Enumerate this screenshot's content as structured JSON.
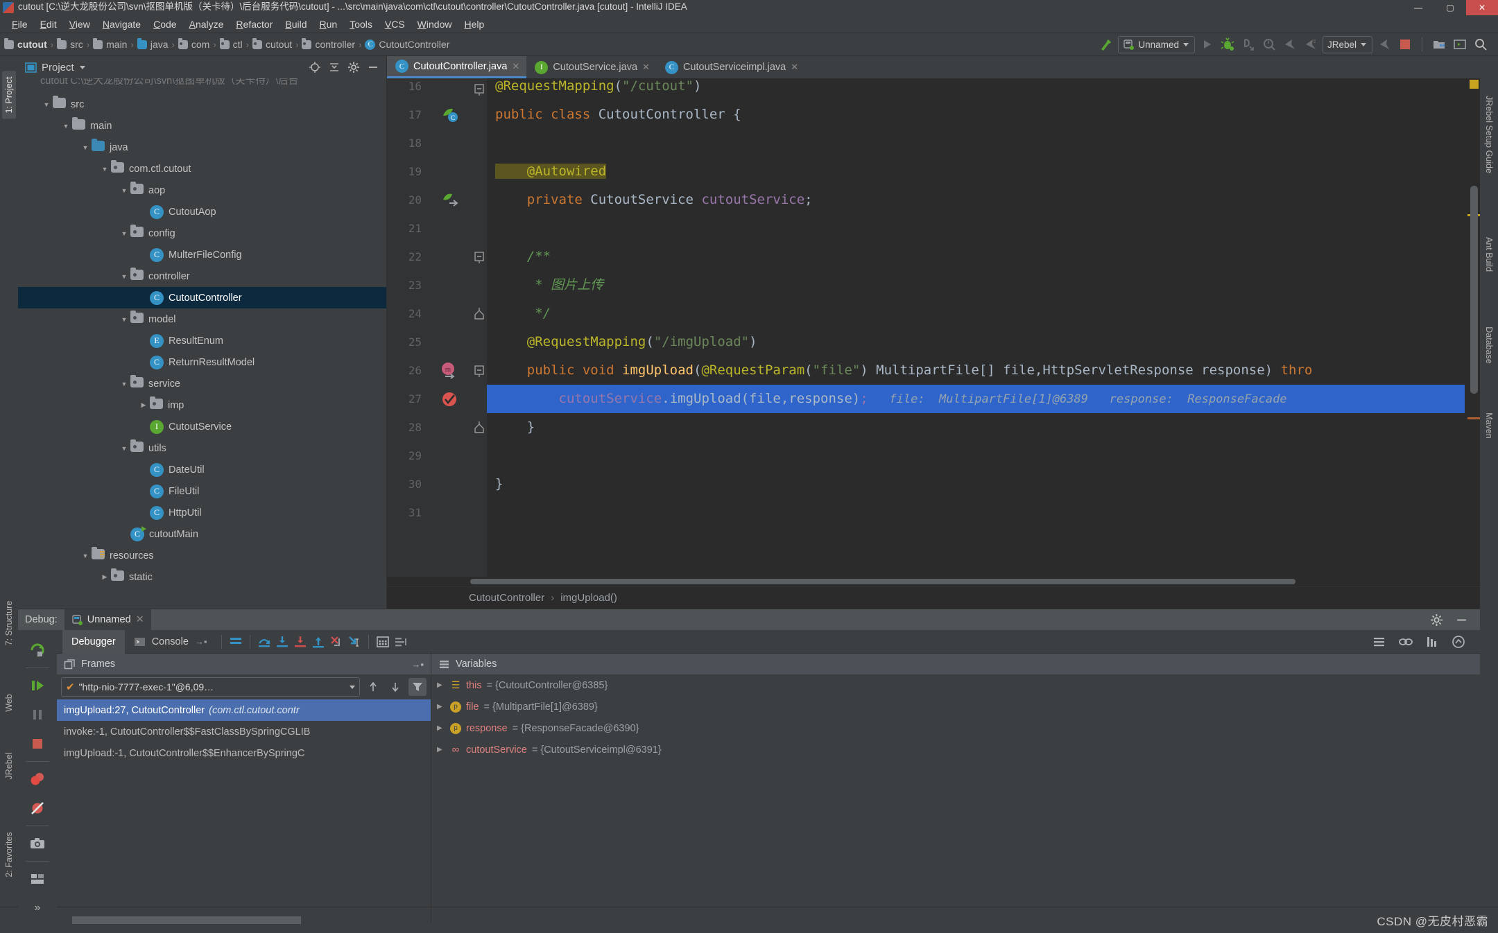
{
  "window": {
    "title": "cutout [C:\\逆大龙股份公司\\svn\\抠图单机版（关卡待）\\后台服务代码\\cutout] - ...\\src\\main\\java\\com\\ctl\\cutout\\controller\\CutoutController.java [cutout] - IntelliJ IDEA",
    "minimize": "—",
    "maximize": "▢",
    "close": "✕"
  },
  "menu": [
    "File",
    "Edit",
    "View",
    "Navigate",
    "Code",
    "Analyze",
    "Refactor",
    "Build",
    "Run",
    "Tools",
    "VCS",
    "Window",
    "Help"
  ],
  "breadcrumb": [
    {
      "label": "cutout",
      "icon": "module-icon",
      "bold": true
    },
    {
      "label": "src",
      "icon": "folder-icon"
    },
    {
      "label": "main",
      "icon": "folder-icon"
    },
    {
      "label": "java",
      "icon": "source-folder-icon"
    },
    {
      "label": "com",
      "icon": "package-icon"
    },
    {
      "label": "ctl",
      "icon": "package-icon"
    },
    {
      "label": "cutout",
      "icon": "package-icon"
    },
    {
      "label": "controller",
      "icon": "package-icon"
    },
    {
      "label": "CutoutController",
      "icon": "class-icon"
    }
  ],
  "toolbar": {
    "run_config": "Unnamed",
    "jrebel": "JRebel",
    "buttons": [
      "build-icon",
      "run-icon",
      "debug-icon",
      "run-with-coverage-icon",
      "profile-icon",
      "jrebel-run-icon",
      "jrebel-debug-icon",
      "jrebel-stop-icon",
      "stop-icon",
      "project-structure-icon",
      "terminal-icon",
      "search-icon"
    ]
  },
  "left_tool_window_bar": [
    {
      "label": "1: Project",
      "selected": true
    },
    {
      "label": "7: Structure",
      "selected": false
    },
    {
      "label": "Web",
      "selected": false
    },
    {
      "label": "JRebel",
      "selected": false
    },
    {
      "label": "2: Favorites",
      "selected": false
    }
  ],
  "right_tool_window_bar": [
    {
      "label": "JRebel Setup Guide"
    },
    {
      "label": "Ant Build"
    },
    {
      "label": "Database"
    },
    {
      "label": "Maven"
    }
  ],
  "project_panel": {
    "title": "Project",
    "header_icons": [
      "locate-icon",
      "collapse-all-icon",
      "settings-icon",
      "hide-icon"
    ],
    "root_clipped": "cutout C:\\逆大龙股份公司\\svn\\抠图单机版（关卡待）\\后台",
    "tree": [
      {
        "label": "src",
        "depth": 1,
        "type": "folder",
        "state": "open"
      },
      {
        "label": "main",
        "depth": 2,
        "type": "folder",
        "state": "open"
      },
      {
        "label": "java",
        "depth": 3,
        "type": "source-folder",
        "state": "open"
      },
      {
        "label": "com.ctl.cutout",
        "depth": 4,
        "type": "package",
        "state": "open"
      },
      {
        "label": "aop",
        "depth": 5,
        "type": "package",
        "state": "open"
      },
      {
        "label": "CutoutAop",
        "depth": 6,
        "type": "class",
        "state": "leaf"
      },
      {
        "label": "config",
        "depth": 5,
        "type": "package",
        "state": "open"
      },
      {
        "label": "MulterFileConfig",
        "depth": 6,
        "type": "class",
        "state": "leaf"
      },
      {
        "label": "controller",
        "depth": 5,
        "type": "package",
        "state": "open"
      },
      {
        "label": "CutoutController",
        "depth": 6,
        "type": "class",
        "state": "leaf",
        "selected": true
      },
      {
        "label": "model",
        "depth": 5,
        "type": "package",
        "state": "open"
      },
      {
        "label": "ResultEnum",
        "depth": 6,
        "type": "enum",
        "state": "leaf"
      },
      {
        "label": "ReturnResultModel",
        "depth": 6,
        "type": "class",
        "state": "leaf"
      },
      {
        "label": "service",
        "depth": 5,
        "type": "package",
        "state": "open"
      },
      {
        "label": "imp",
        "depth": 6,
        "type": "package",
        "state": "closed"
      },
      {
        "label": "CutoutService",
        "depth": 6,
        "type": "interface",
        "state": "leaf"
      },
      {
        "label": "utils",
        "depth": 5,
        "type": "package",
        "state": "open"
      },
      {
        "label": "DateUtil",
        "depth": 6,
        "type": "class",
        "state": "leaf"
      },
      {
        "label": "FileUtil",
        "depth": 6,
        "type": "class",
        "state": "leaf"
      },
      {
        "label": "HttpUtil",
        "depth": 6,
        "type": "class",
        "state": "leaf"
      },
      {
        "label": "cutoutMain",
        "depth": 5,
        "type": "runnable-class",
        "state": "leaf"
      },
      {
        "label": "resources",
        "depth": 3,
        "type": "resource-folder",
        "state": "open"
      },
      {
        "label": "static",
        "depth": 4,
        "type": "package",
        "state": "closed"
      }
    ]
  },
  "editor": {
    "tabs": [
      {
        "label": "CutoutController.java",
        "icon": "class-icon",
        "active": true
      },
      {
        "label": "CutoutService.java",
        "icon": "interface-icon",
        "active": false
      },
      {
        "label": "CutoutServiceimpl.java",
        "icon": "class-icon",
        "active": false
      }
    ],
    "first_line_number": 16,
    "lines": [
      {
        "n": 16,
        "clipped_top": true,
        "fold": "collapse",
        "segments": [
          {
            "t": "@RequestMapping",
            "c": "ann"
          },
          {
            "t": "(",
            "c": "txt"
          },
          {
            "t": "\"/cutout\"",
            "c": "str"
          },
          {
            "t": ")",
            "c": "txt"
          }
        ]
      },
      {
        "n": 17,
        "gutter_icon": "spring-bean-icon",
        "segments": [
          {
            "t": "public class ",
            "c": "kw"
          },
          {
            "t": "CutoutController ",
            "c": "typ"
          },
          {
            "t": "{",
            "c": "txt"
          }
        ]
      },
      {
        "n": 18,
        "segments": []
      },
      {
        "n": 19,
        "segments": [
          {
            "t": "    @Autowired",
            "c": "ann highlight"
          }
        ]
      },
      {
        "n": 20,
        "gutter_icon": "spring-autowired-icon",
        "segments": [
          {
            "t": "    ",
            "c": "txt"
          },
          {
            "t": "private ",
            "c": "kw"
          },
          {
            "t": "CutoutService ",
            "c": "typ"
          },
          {
            "t": "cutoutService",
            "c": "fld"
          },
          {
            "t": ";",
            "c": "txt"
          }
        ]
      },
      {
        "n": 21,
        "segments": []
      },
      {
        "n": 22,
        "fold": "collapse",
        "segments": [
          {
            "t": "    /**",
            "c": "cmt"
          }
        ]
      },
      {
        "n": 23,
        "segments": [
          {
            "t": "     * 图片上传",
            "c": "cmt"
          }
        ]
      },
      {
        "n": 24,
        "fold": "collapse-end",
        "segments": [
          {
            "t": "     */",
            "c": "cmt"
          }
        ]
      },
      {
        "n": 25,
        "segments": [
          {
            "t": "    ",
            "c": "txt"
          },
          {
            "t": "@RequestMapping",
            "c": "ann"
          },
          {
            "t": "(",
            "c": "txt"
          },
          {
            "t": "\"/imgUpload\"",
            "c": "str"
          },
          {
            "t": ")",
            "c": "txt"
          }
        ]
      },
      {
        "n": 26,
        "gutter_icon": "method-breakpoint-icon",
        "fold": "collapse",
        "segments": [
          {
            "t": "    ",
            "c": "txt"
          },
          {
            "t": "public void ",
            "c": "kw"
          },
          {
            "t": "imgUpload",
            "c": "mth"
          },
          {
            "t": "(",
            "c": "txt"
          },
          {
            "t": "@RequestParam",
            "c": "ann"
          },
          {
            "t": "(",
            "c": "txt"
          },
          {
            "t": "\"file\"",
            "c": "str"
          },
          {
            "t": ") ",
            "c": "txt"
          },
          {
            "t": "MultipartFile[] file,HttpServletResponse response",
            "c": "typ"
          },
          {
            "t": ") ",
            "c": "txt"
          },
          {
            "t": "thro",
            "c": "kw"
          }
        ]
      },
      {
        "n": 27,
        "highlighted": true,
        "gutter_icon": "breakpoint-hit-icon",
        "segments": [
          {
            "t": "        ",
            "c": "txt"
          },
          {
            "t": "cutoutService",
            "c": "fld"
          },
          {
            "t": ".",
            "c": "txt"
          },
          {
            "t": "imgUpload",
            "c": "txt"
          },
          {
            "t": "(file,response)",
            "c": "txt"
          },
          {
            "t": ";",
            "c": "fld"
          },
          {
            "t": "   file:  MultipartFile[1]@6389   response:  ResponseFacade",
            "c": "inline-debug"
          }
        ]
      },
      {
        "n": 28,
        "fold": "collapse-end",
        "segments": [
          {
            "t": "    }",
            "c": "txt"
          }
        ]
      },
      {
        "n": 29,
        "segments": []
      },
      {
        "n": 30,
        "segments": [
          {
            "t": "}",
            "c": "txt"
          }
        ]
      },
      {
        "n": 31,
        "segments": []
      }
    ],
    "breadcrumbs": [
      "CutoutController",
      "imgUpload()"
    ]
  },
  "debug": {
    "header_label": "Debug:",
    "session_tab": "Unnamed",
    "tabs": [
      {
        "label": "Debugger",
        "active": true,
        "icon": null
      },
      {
        "label": "Console",
        "active": false,
        "icon": "console-icon"
      }
    ],
    "toolbar_icons": [
      "show-execution-point-icon",
      "step-over-icon",
      "step-into-icon",
      "force-step-into-icon",
      "step-out-icon",
      "drop-frame-icon",
      "run-to-cursor-icon",
      "evaluate-expression-icon",
      "layout-icon"
    ],
    "side_icons": [
      "rerun-icon",
      "resume-icon",
      "pause-icon",
      "stop-icon",
      "view-breakpoints-icon",
      "mute-breakpoints-icon",
      "camera-icon",
      "layout-settings-icon",
      "more-icon"
    ],
    "right_icons": [
      "settings-icon",
      "hide-icon"
    ],
    "frames": {
      "title": "Frames",
      "thread": "\"http-nio-7777-exec-1\"@6,09…",
      "thread_toolbar": [
        "up-icon",
        "down-icon",
        "filter-icon"
      ],
      "items": [
        {
          "method": "imgUpload:27, CutoutController",
          "pkg": "(com.ctl.cutout.contr",
          "selected": true
        },
        {
          "method": "invoke:-1, CutoutController$$FastClassBySpringCGLIB",
          "pkg": "",
          "selected": false
        },
        {
          "method": "imgUpload:-1, CutoutController$$EnhancerBySpringC",
          "pkg": "",
          "selected": false
        }
      ]
    },
    "variables": {
      "title": "Variables",
      "items": [
        {
          "name": "this",
          "value": "= {CutoutController@6385}",
          "icon": "stack-frame-icon"
        },
        {
          "name": "file",
          "value": "= {MultipartFile[1]@6389}",
          "icon": "parameter-icon"
        },
        {
          "name": "response",
          "value": "= {ResponseFacade@6390}",
          "icon": "parameter-icon"
        },
        {
          "name": "cutoutService",
          "value": "= {CutoutServiceimpl@6391}",
          "icon": "field-icon"
        }
      ]
    }
  },
  "status_bar": {
    "watermark": "CSDN @无皮村恶霸"
  },
  "colors": {
    "accent_blue": "#4a88c7",
    "selection_blue": "#2f65ca",
    "tree_selection": "#0d293e",
    "frame_selection": "#4b6eaf",
    "editor_bg": "#2b2b2b",
    "panel_bg": "#3c3f41",
    "keyword_orange": "#cc7832",
    "annotation_yellow": "#bbb529",
    "string_green": "#6a8759",
    "comment_green": "#629755",
    "field_purple": "#9876aa",
    "method_gold": "#ffc66d"
  }
}
